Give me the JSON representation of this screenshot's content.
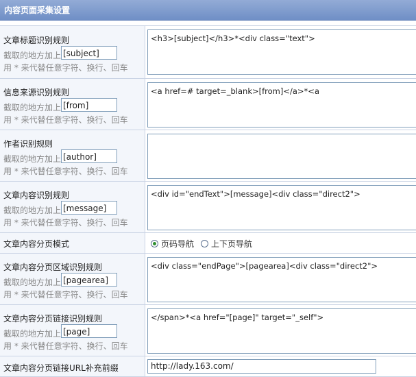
{
  "header": {
    "title": "内容页面采集设置"
  },
  "hint_prefix": "截取的地方加上",
  "hint_line": "用 * 来代替任意字符、换行、回车",
  "rules": [
    {
      "label": "文章标题识别规则",
      "tag": "[subject]",
      "value": "<h3>[subject]</h3>*<div class=\"text\">"
    },
    {
      "label": "信息来源识别规则",
      "tag": "[from]",
      "value": "<a href=# target=_blank>[from]</a>*<a"
    },
    {
      "label": "作者识别规则",
      "tag": "[author]",
      "value": ""
    },
    {
      "label": "文章内容识别规则",
      "tag": "[message]",
      "value": "<div id=\"endText\">[message]<div class=\"direct2\">"
    }
  ],
  "paging_mode": {
    "label": "文章内容分页模式",
    "options": [
      {
        "label": "页码导航",
        "selected": true
      },
      {
        "label": "上下页导航",
        "selected": false
      }
    ]
  },
  "rules2": [
    {
      "label": "文章内容分页区域识别规则",
      "tag": "[pagearea]",
      "value": "<div class=\"endPage\">[pagearea]<div class=\"direct2\">"
    },
    {
      "label": "文章内容分页链接识别规则",
      "tag": "[page]",
      "value": "</span>*<a href=\"[page]\" target=\"_self\">"
    }
  ],
  "url_prefix": {
    "label": "文章内容分页链接URL补充前缀",
    "value": "http://lady.163.com/"
  }
}
